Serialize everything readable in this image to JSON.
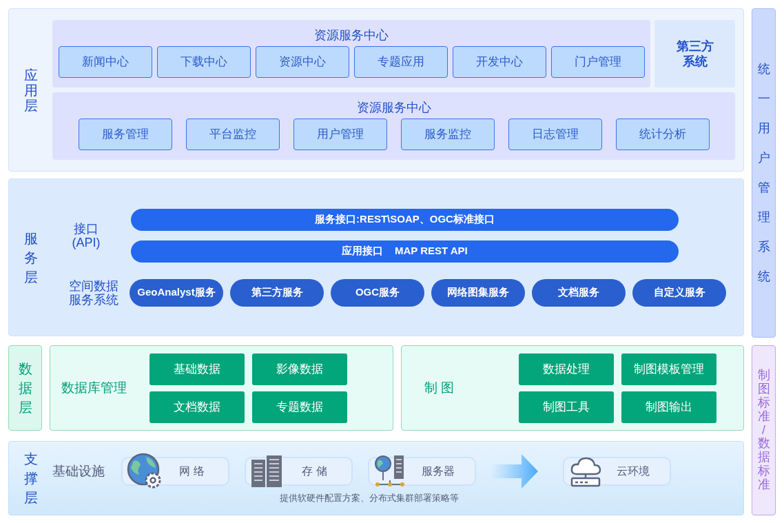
{
  "app_layer": {
    "label": "应用层",
    "portal": {
      "title": "资源服务中心",
      "items": [
        "新闻中心",
        "下载中心",
        "资源中心",
        "专题应用",
        "开发中心",
        "门户管理"
      ]
    },
    "third_party": "第三方系统",
    "management": {
      "title": "资源服务中心",
      "items": [
        "服务管理",
        "平台监控",
        "用户管理",
        "服务监控",
        "日志管理",
        "统计分析"
      ]
    }
  },
  "service_layer": {
    "label": "服务层",
    "interface_label": "接口\n(API)",
    "bars": [
      "服务接口:REST\\SOAP、OGC标准接口",
      "应用接口    MAP REST API"
    ],
    "spatial_label": "空间数据服务系统",
    "services": [
      "GeoAnalyst服务",
      "第三方服务",
      "OGC服务",
      "网络图集服务",
      "文档服务",
      "自定义服务"
    ]
  },
  "data_layer": {
    "label": "数据层",
    "database": {
      "title": "数据库管理",
      "items": [
        "基础数据",
        "影像数据",
        "文档数据",
        "专题数据"
      ]
    },
    "mapping": {
      "title": "制 图",
      "items": [
        "数据处理",
        "制图模板管理",
        "制图工具",
        "制图输出"
      ]
    }
  },
  "infra_layer": {
    "label": "支撑层",
    "title": "基础设施",
    "items": [
      {
        "kind": "network",
        "label": "网 络"
      },
      {
        "kind": "storage",
        "label": "存 储"
      },
      {
        "kind": "server",
        "label": "服务器"
      },
      {
        "kind": "cloud",
        "label": "云环境"
      }
    ],
    "note": "提供软硬件配置方案、分布式集群部署策略等"
  },
  "side": {
    "user_system": "统一用户管理系统",
    "standards": "制图标准/数据标准"
  }
}
